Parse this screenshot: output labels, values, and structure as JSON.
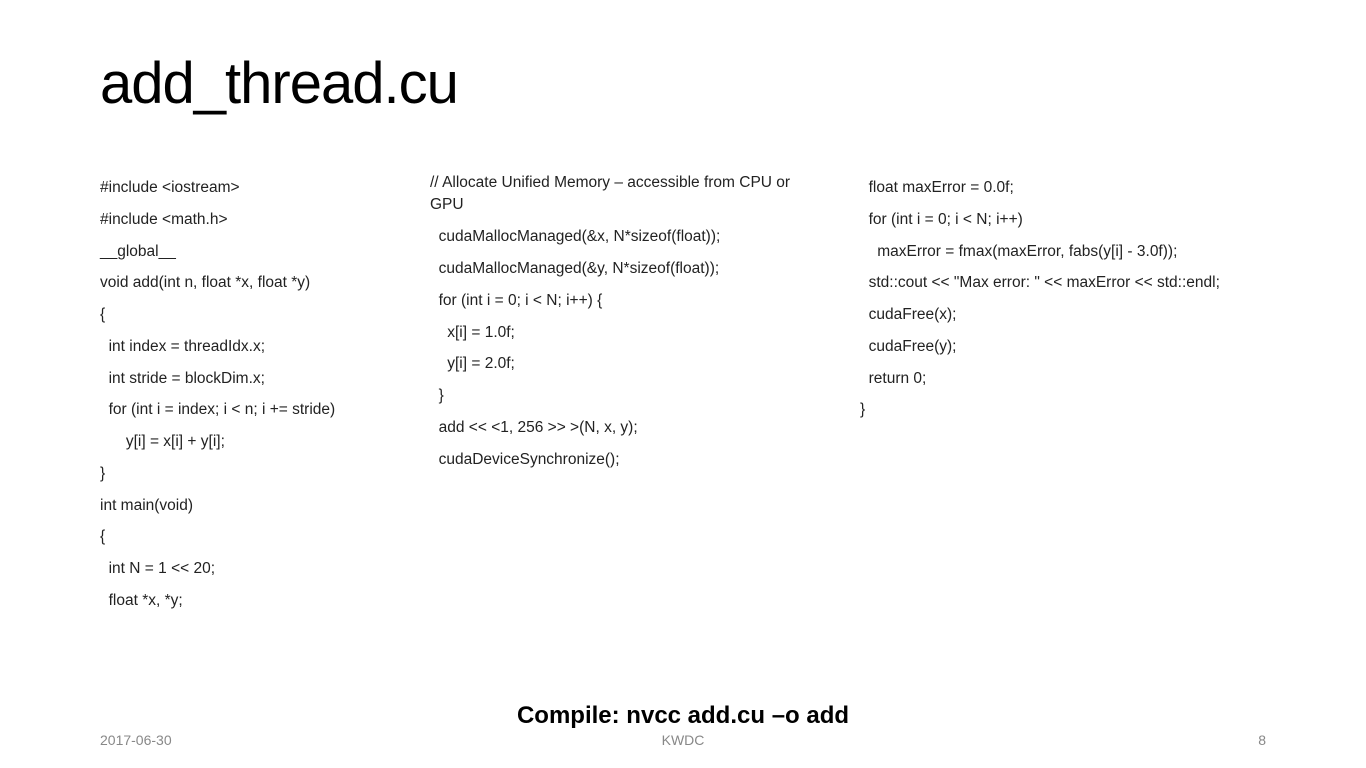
{
  "title": "add_thread.cu",
  "col1": [
    "#include <iostream>",
    "#include <math.h>",
    "__global__",
    "void add(int n, float *x, float *y)",
    "{",
    "  int index = threadIdx.x;",
    "  int stride = blockDim.x;",
    "  for (int i = index; i < n; i += stride)",
    "      y[i] = x[i] + y[i];",
    "}",
    "",
    "int main(void)",
    "{",
    "  int N = 1 << 20;",
    "  float *x, *y;"
  ],
  "col2": [
    "// Allocate Unified Memory – accessible from CPU or GPU",
    "  cudaMallocManaged(&x, N*sizeof(float));",
    "  cudaMallocManaged(&y, N*sizeof(float));",
    "",
    "  for (int i = 0; i < N; i++) {",
    "    x[i] = 1.0f;",
    "    y[i] = 2.0f;",
    "  }",
    "",
    "  add << <1, 256 >> >(N, x, y);",
    "",
    "  cudaDeviceSynchronize();"
  ],
  "col3": [
    "  float maxError = 0.0f;",
    "  for (int i = 0; i < N; i++)",
    "    maxError = fmax(maxError, fabs(y[i] - 3.0f));",
    "",
    "  std::cout << \"Max error: \" << maxError << std::endl;",
    "",
    "  cudaFree(x);",
    "  cudaFree(y);",
    "",
    "  return 0;",
    "}"
  ],
  "compile": "Compile: nvcc add.cu –o add",
  "footer": {
    "date": "2017-06-30",
    "center": "KWDC",
    "page": "8"
  }
}
